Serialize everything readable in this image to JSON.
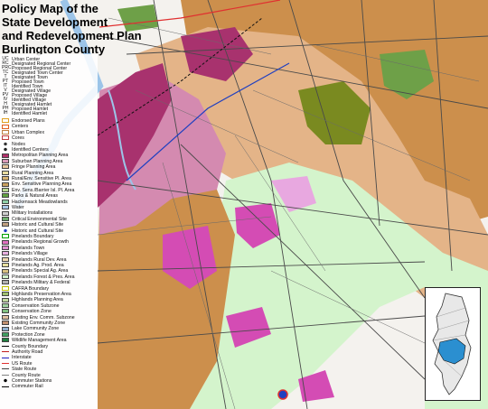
{
  "title_lines": [
    "Policy Map of the",
    "State Development",
    "and Redevelopment Plan",
    "Burlington County"
  ],
  "center_codes": [
    {
      "code": "UC",
      "label": "Urban Center"
    },
    {
      "code": "RC",
      "label": "Designated Regional Center"
    },
    {
      "code": "PRC",
      "label": "Proposed Regional Center"
    },
    {
      "code": "TC",
      "label": "Designated Town Center"
    },
    {
      "code": "T",
      "label": "Designated Town"
    },
    {
      "code": "PT",
      "label": "Proposed Town"
    },
    {
      "code": "IT",
      "label": "Identified Town"
    },
    {
      "code": "V",
      "label": "Designated Village"
    },
    {
      "code": "PV",
      "label": "Proposed Village"
    },
    {
      "code": "IV",
      "label": "Identified Village"
    },
    {
      "code": "H",
      "label": "Designated Hamlet"
    },
    {
      "code": "PH",
      "label": "Proposed Hamlet"
    },
    {
      "code": "IH",
      "label": "Identified Hamlet"
    }
  ],
  "legend_items": [
    {
      "label": "Endorsed Plans",
      "kind": "outline",
      "color": "#e0a020"
    },
    {
      "label": "Centers",
      "kind": "outline",
      "color": "#e06020"
    },
    {
      "label": "Urban Complex",
      "kind": "outline",
      "color": "#c08040"
    },
    {
      "label": "Cores",
      "kind": "outline",
      "color": "#c04040"
    },
    {
      "label": "Nodes",
      "kind": "dot",
      "color": "#333333"
    },
    {
      "label": "Identified Centers",
      "kind": "dot",
      "color": "#222222"
    },
    {
      "label": "Metropolitan Planning Area",
      "kind": "fill",
      "color": "#b0306a"
    },
    {
      "label": "Suburban Planning Area",
      "kind": "fill",
      "color": "#d89ab8"
    },
    {
      "label": "Fringe Planning Area",
      "kind": "fill",
      "color": "#e8c8a0"
    },
    {
      "label": "Rural Planning Area",
      "kind": "fill",
      "color": "#e8dca0"
    },
    {
      "label": "Rural/Env. Sensitive Pl. Area",
      "kind": "fill",
      "color": "#d4b070"
    },
    {
      "label": "Env. Sensitive Planning Area",
      "kind": "fill",
      "color": "#c8a060"
    },
    {
      "label": "Env. Sens./Barrier Isl. Pl. Area",
      "kind": "fill",
      "color": "#b8d890"
    },
    {
      "label": "Parks & Natural Areas",
      "kind": "fill",
      "color": "#60a040"
    },
    {
      "label": "Hackensack Meadowlands",
      "kind": "fill",
      "color": "#8fd0a8"
    },
    {
      "label": "Water",
      "kind": "fill",
      "color": "#a8c8e8"
    },
    {
      "label": "Military Installations",
      "kind": "fill",
      "color": "#d0d0d0"
    },
    {
      "label": "Critical Environmental Site",
      "kind": "fill",
      "color": "#70b070"
    },
    {
      "label": "Historic and Cultural Site",
      "kind": "fill",
      "color": "#c0a080"
    },
    {
      "label": "Historic and Cultural Site",
      "kind": "dot",
      "color": "#2040c0"
    },
    {
      "label": "Pinelands Boundary",
      "kind": "outline",
      "color": "#00a000"
    },
    {
      "label": "Pinelands Regional Growth",
      "kind": "fill",
      "color": "#e070c0"
    },
    {
      "label": "Pinelands Town",
      "kind": "fill",
      "color": "#e090d0"
    },
    {
      "label": "Pinelands Village",
      "kind": "fill",
      "color": "#e8b0e0"
    },
    {
      "label": "Pinelands Rural Dev. Area",
      "kind": "fill",
      "color": "#f0d8b0"
    },
    {
      "label": "Pinelands Ag. Prod. Area",
      "kind": "fill",
      "color": "#e8e0a0"
    },
    {
      "label": "Pinelands Special Ag. Area",
      "kind": "fill",
      "color": "#d8c080"
    },
    {
      "label": "Pinelands Forest & Pres. Area",
      "kind": "fill",
      "color": "#d0f0c8"
    },
    {
      "label": "Pinelands Military & Federal",
      "kind": "fill",
      "color": "#b0b0b0"
    },
    {
      "label": "CAFRA Boundary",
      "kind": "outline",
      "color": "#c0c000"
    },
    {
      "label": "Highlands Preservation Area",
      "kind": "fill",
      "color": "#a0c070"
    },
    {
      "label": "Highlands Planning Area",
      "kind": "fill",
      "color": "#c0d8a0"
    },
    {
      "label": "Conservation Subzone",
      "kind": "fill",
      "color": "#a0d0a0"
    },
    {
      "label": "Conservation Zone",
      "kind": "fill",
      "color": "#80c080"
    },
    {
      "label": "Existing Env. Comm. Subzone",
      "kind": "fill",
      "color": "#e0c0a0"
    },
    {
      "label": "Existing Community Zone",
      "kind": "fill",
      "color": "#c09070"
    },
    {
      "label": "Lake Community Zone",
      "kind": "fill",
      "color": "#90b0d0"
    },
    {
      "label": "Protection Zone",
      "kind": "fill",
      "color": "#40a060"
    },
    {
      "label": "Wildlife Management Area",
      "kind": "fill",
      "color": "#208040"
    },
    {
      "label": "County Boundary",
      "kind": "line",
      "color": "#000000"
    },
    {
      "label": "Authority Road",
      "kind": "line",
      "color": "#c02020"
    },
    {
      "label": "Interstate",
      "kind": "line",
      "color": "#2020c0"
    },
    {
      "label": "US Route",
      "kind": "line",
      "color": "#e03030"
    },
    {
      "label": "State Route",
      "kind": "line",
      "color": "#404040"
    },
    {
      "label": "County Route",
      "kind": "line",
      "color": "#808080"
    },
    {
      "label": "Commuter Stations",
      "kind": "dot",
      "color": "#000000"
    },
    {
      "label": "Commuter Rail",
      "kind": "line",
      "color": "#000000"
    }
  ],
  "colors": {
    "metropolitan": "#a8326e",
    "suburban": "#d48ab0",
    "fringe": "#e4b488",
    "rural": "#d8a868",
    "rural_env": "#cc8f4c",
    "env_sensitive": "#c4904e",
    "pinelands_forest": "#d4f4cc",
    "pinelands_growth": "#d44cb4",
    "pinelands_village": "#e8a8e0",
    "pinelands_rural": "#f0dcb0",
    "parks": "#6ea048",
    "wildlife": "#7a8a20",
    "water": "#9cc4e8",
    "roads": "#4a4a4a",
    "us_route": "#e03030",
    "interstate": "#2040c0"
  }
}
